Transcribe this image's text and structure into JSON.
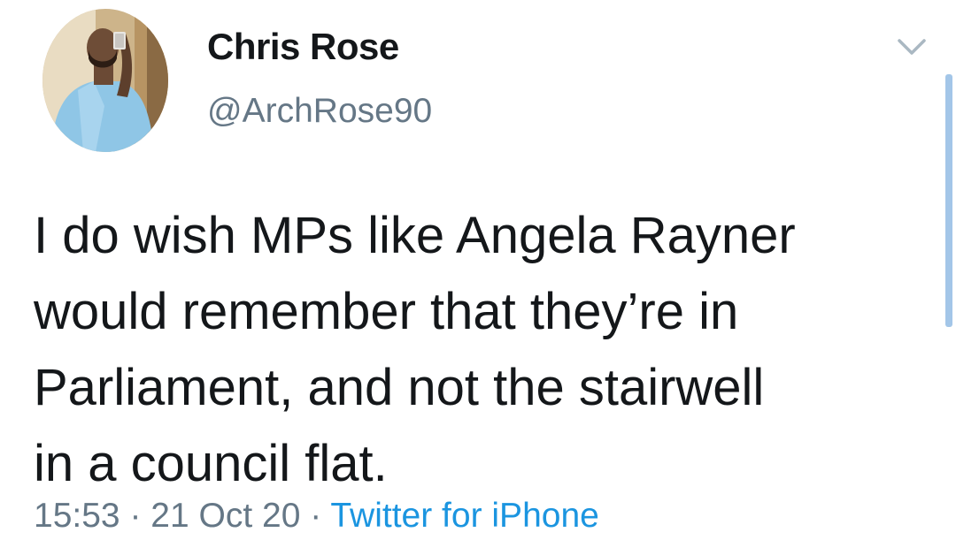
{
  "tweet": {
    "author": {
      "display_name": "Chris Rose",
      "handle": "@ArchRose90",
      "avatar_icon": "profile-photo"
    },
    "menu_icon": "chevron-down-icon",
    "text_lines": [
      "I do wish MPs like Angela Rayner",
      "would remember that they’re in",
      "Parliament, and not the stairwell",
      "in a council flat."
    ],
    "meta": {
      "time": "15:53",
      "separator": " · ",
      "date": "21 Oct 20",
      "source": "Twitter for iPhone"
    }
  },
  "colors": {
    "text": "#14171a",
    "secondary": "#657786",
    "link": "#1b95e0",
    "scrollbar": "#a3c6e8"
  }
}
